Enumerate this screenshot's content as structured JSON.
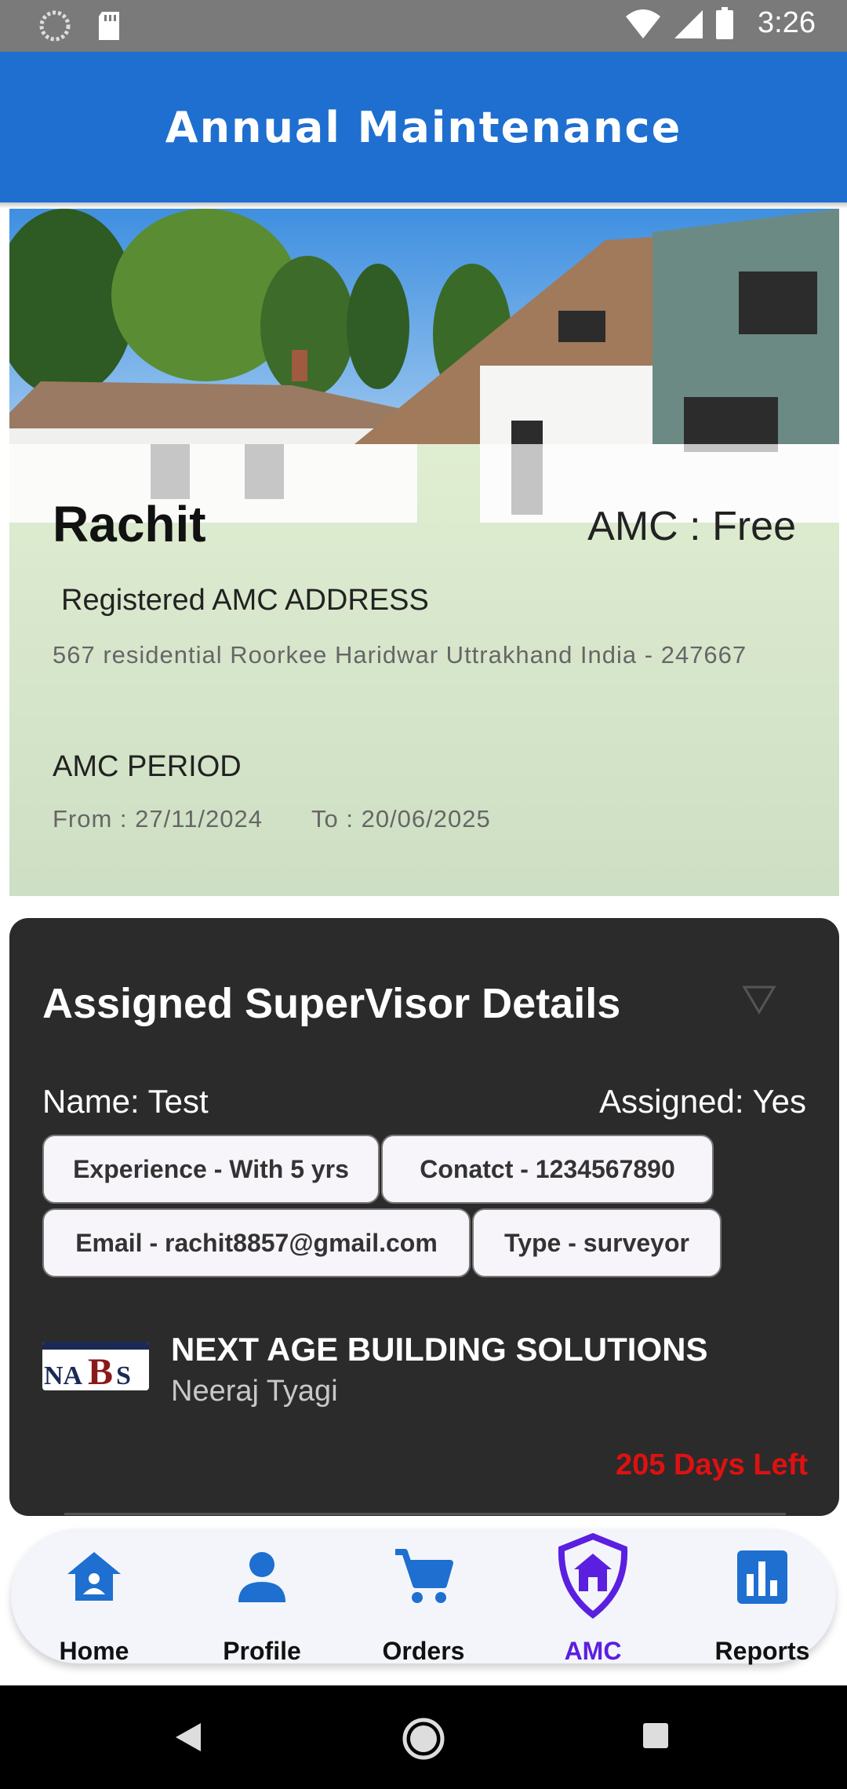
{
  "status_bar": {
    "time": "3:26"
  },
  "app_bar": {
    "title": "Annual Maintenance"
  },
  "amc": {
    "owner_name": "Rachit",
    "amc_type": "AMC : Free",
    "address_label": "Registered AMC ADDRESS",
    "address": "567 residential Roorkee Haridwar  Uttrakhand   India - 247667",
    "period_label": "AMC PERIOD",
    "period_from": "From : 27/11/2024",
    "period_to": "To : 20/06/2025"
  },
  "supervisor": {
    "title": "Assigned SuperVisor Details",
    "name": "Name: Test",
    "assigned": "Assigned: Yes",
    "chips": {
      "experience": "Experience - With 5 yrs",
      "contact": "Conatct - 1234567890",
      "email": "Email - rachit8857@gmail.com",
      "type": "Type - surveyor"
    },
    "company_logo": "NABS",
    "company_name": "NEXT AGE BUILDING SOLUTIONS",
    "company_person": "Neeraj Tyagi",
    "days_left": "205 Days Left"
  },
  "bottom_nav": {
    "items": [
      {
        "label": "Home",
        "icon": "home-icon"
      },
      {
        "label": "Profile",
        "icon": "person-icon"
      },
      {
        "label": "Orders",
        "icon": "cart-icon"
      },
      {
        "label": "AMC",
        "icon": "shield-home-icon"
      },
      {
        "label": "Reports",
        "icon": "chart-icon"
      }
    ],
    "active": "AMC"
  },
  "colors": {
    "app_bar": "#1e6fd0",
    "nav_icon": "#1e6fd0",
    "active_nav": "#5b1fe0",
    "days_left": "#e01010",
    "card_dark": "#2b2b2b"
  }
}
